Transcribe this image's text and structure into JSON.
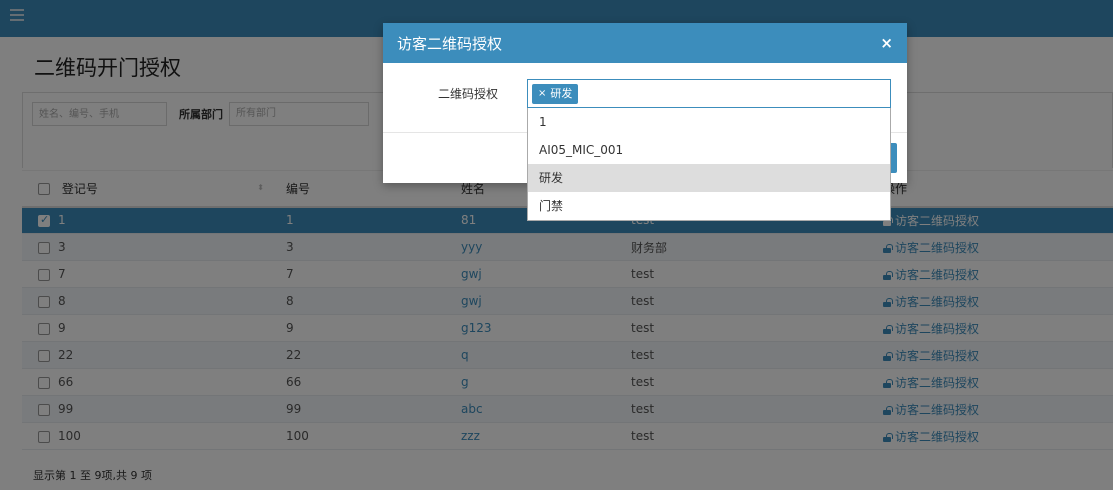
{
  "page": {
    "title": "二维码开门授权"
  },
  "filter": {
    "search_placeholder": "姓名、编号、手机",
    "dept_label": "所属部门",
    "dept_value": "所有部门"
  },
  "table": {
    "headers": [
      "登记号",
      "编号",
      "姓名",
      "",
      "操作"
    ],
    "rows": [
      {
        "reg": "1",
        "num": "1",
        "name": "81",
        "dept": "test",
        "action": "访客二维码授权",
        "selected": true
      },
      {
        "reg": "3",
        "num": "3",
        "name": "yyy",
        "dept": "财务部",
        "action": "访客二维码授权",
        "selected": false
      },
      {
        "reg": "7",
        "num": "7",
        "name": "gwj",
        "dept": "test",
        "action": "访客二维码授权",
        "selected": false
      },
      {
        "reg": "8",
        "num": "8",
        "name": "gwj",
        "dept": "test",
        "action": "访客二维码授权",
        "selected": false
      },
      {
        "reg": "9",
        "num": "9",
        "name": "g123",
        "dept": "test",
        "action": "访客二维码授权",
        "selected": false
      },
      {
        "reg": "22",
        "num": "22",
        "name": "q",
        "dept": "test",
        "action": "访客二维码授权",
        "selected": false
      },
      {
        "reg": "66",
        "num": "66",
        "name": "g",
        "dept": "test",
        "action": "访客二维码授权",
        "selected": false
      },
      {
        "reg": "99",
        "num": "99",
        "name": "abc",
        "dept": "test",
        "action": "访客二维码授权",
        "selected": false
      },
      {
        "reg": "100",
        "num": "100",
        "name": "zzz",
        "dept": "test",
        "action": "访客二维码授权",
        "selected": false
      }
    ]
  },
  "pagination": {
    "info": "显示第 1 至 9项,共 9 项"
  },
  "modal": {
    "title": "访客二维码授权",
    "close_symbol": "×",
    "field_label": "二维码授权",
    "selected_tag": "研发",
    "tag_remove_symbol": "×",
    "options": [
      {
        "label": "1",
        "highlighted": false
      },
      {
        "label": "AI05_MIC_001",
        "highlighted": false
      },
      {
        "label": "研发",
        "highlighted": true
      },
      {
        "label": "门禁",
        "highlighted": false
      }
    ]
  },
  "icons": {
    "menu": "menu-icon",
    "lock": "lock-icon",
    "close": "close-icon",
    "sort": "sort-icon"
  },
  "colors": {
    "primary": "#3c8dbc",
    "overlay": "rgba(0,0,0,0.5)",
    "highlight_option": "#dddddd"
  }
}
